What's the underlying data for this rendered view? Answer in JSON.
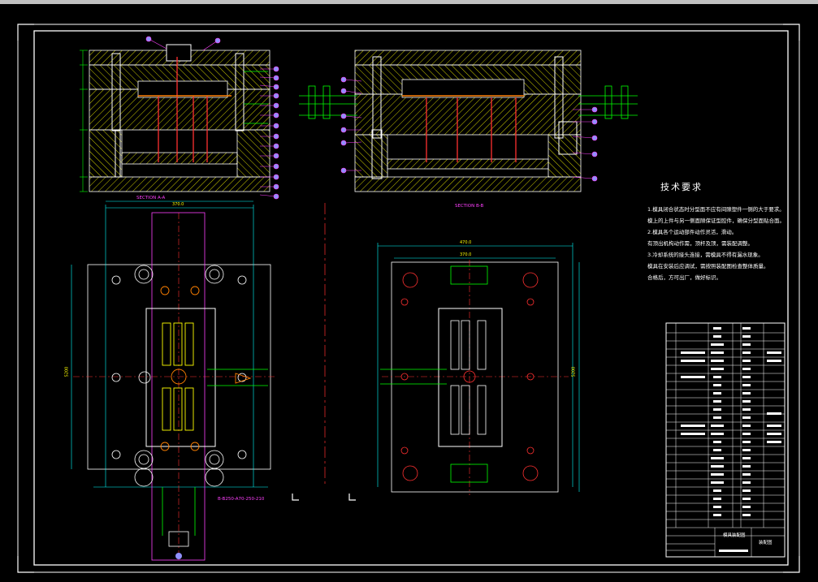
{
  "drawing": {
    "technical_requirements": {
      "title": "技术要求",
      "items": [
        "1.模具闭合状态时分型面不应有间隙塑件一侧的大于要求。",
        "模上的上件与另一侧面隙保证型腔件，确保分型面贴合面。",
        "2.模具各个运动部件动作灵活，滑动。",
        "有顶出机构动作需，顶杆及顶，需装配调整。",
        "3.冷却系统的接头连接，需模具不得有漏水现象。",
        "模具在安装后应调试，需按照装配图检查整体质量。",
        "合格后，方可出厂，做好标识。"
      ]
    },
    "section_labels": {
      "section_aa": "SECTION A-A",
      "section_bb": "SECTION B-B",
      "bottom_label": "B-B250-A70-250-210"
    },
    "dimensions": {
      "top_left_width": "370.0",
      "top_left_inner": "370.0",
      "top_right_width": "470.0",
      "top_right_inner": "370.0",
      "left_height": "5200",
      "right_height": "5200",
      "side_dims": [
        "85",
        "50",
        "100",
        "50",
        "350"
      ]
    },
    "title_block": {
      "part_name": "模具装配图",
      "drawing_no": "装配图",
      "scale": "1:1",
      "material": "装配体"
    },
    "colors": {
      "background": "#000000",
      "frame": "#ffffff",
      "hatch": "#ffff00",
      "leader": "#ff00ff",
      "part_outline": "#ffffff",
      "ejector": "#ff0000",
      "dimension": "#00ffff",
      "cooling": "#00ff00"
    }
  }
}
